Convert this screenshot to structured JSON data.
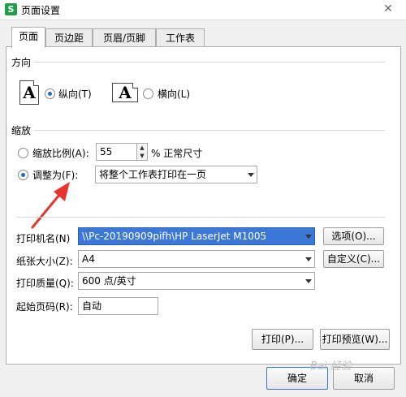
{
  "window": {
    "title": "页面设置",
    "app_icon": "S",
    "close_glyph": "✕"
  },
  "tabs": [
    {
      "label": "页面",
      "active": true
    },
    {
      "label": "页边距",
      "active": false
    },
    {
      "label": "页眉/页脚",
      "active": false
    },
    {
      "label": "工作表",
      "active": false
    }
  ],
  "orientation": {
    "title": "方向",
    "portrait_label": "纵向(T)",
    "landscape_label": "横向(L)",
    "icon_letter": "A",
    "selected": "portrait"
  },
  "scaling": {
    "title": "缩放",
    "scale_label": "缩放比例(A):",
    "scale_value": "55",
    "scale_suffix": "% 正常尺寸",
    "fit_label": "调整为(F):",
    "fit_value": "将整个工作表打印在一页",
    "selected": "fit"
  },
  "printer": {
    "name_label": "打印机名(N)",
    "name_value": "\\\\Pc-20190909pifh\\HP LaserJet M1005",
    "options_button": "选项(O)...",
    "paper_label": "纸张大小(Z):",
    "paper_value": "A4",
    "custom_button": "自定义(C)...",
    "quality_label": "打印质量(Q):",
    "quality_value": "600 点/英寸",
    "start_page_label": "起始页码(R):",
    "start_page_value": "自动"
  },
  "actions": {
    "print": "打印(P)...",
    "preview": "打印预览(W)...",
    "ok": "确定",
    "cancel": "取消"
  },
  "watermark": "Bai 经验",
  "colors": {
    "arrow": "#e8332e",
    "selection": "#3c78d8",
    "radio_dot": "#2366c5",
    "app_icon": "#1f9e4a"
  }
}
